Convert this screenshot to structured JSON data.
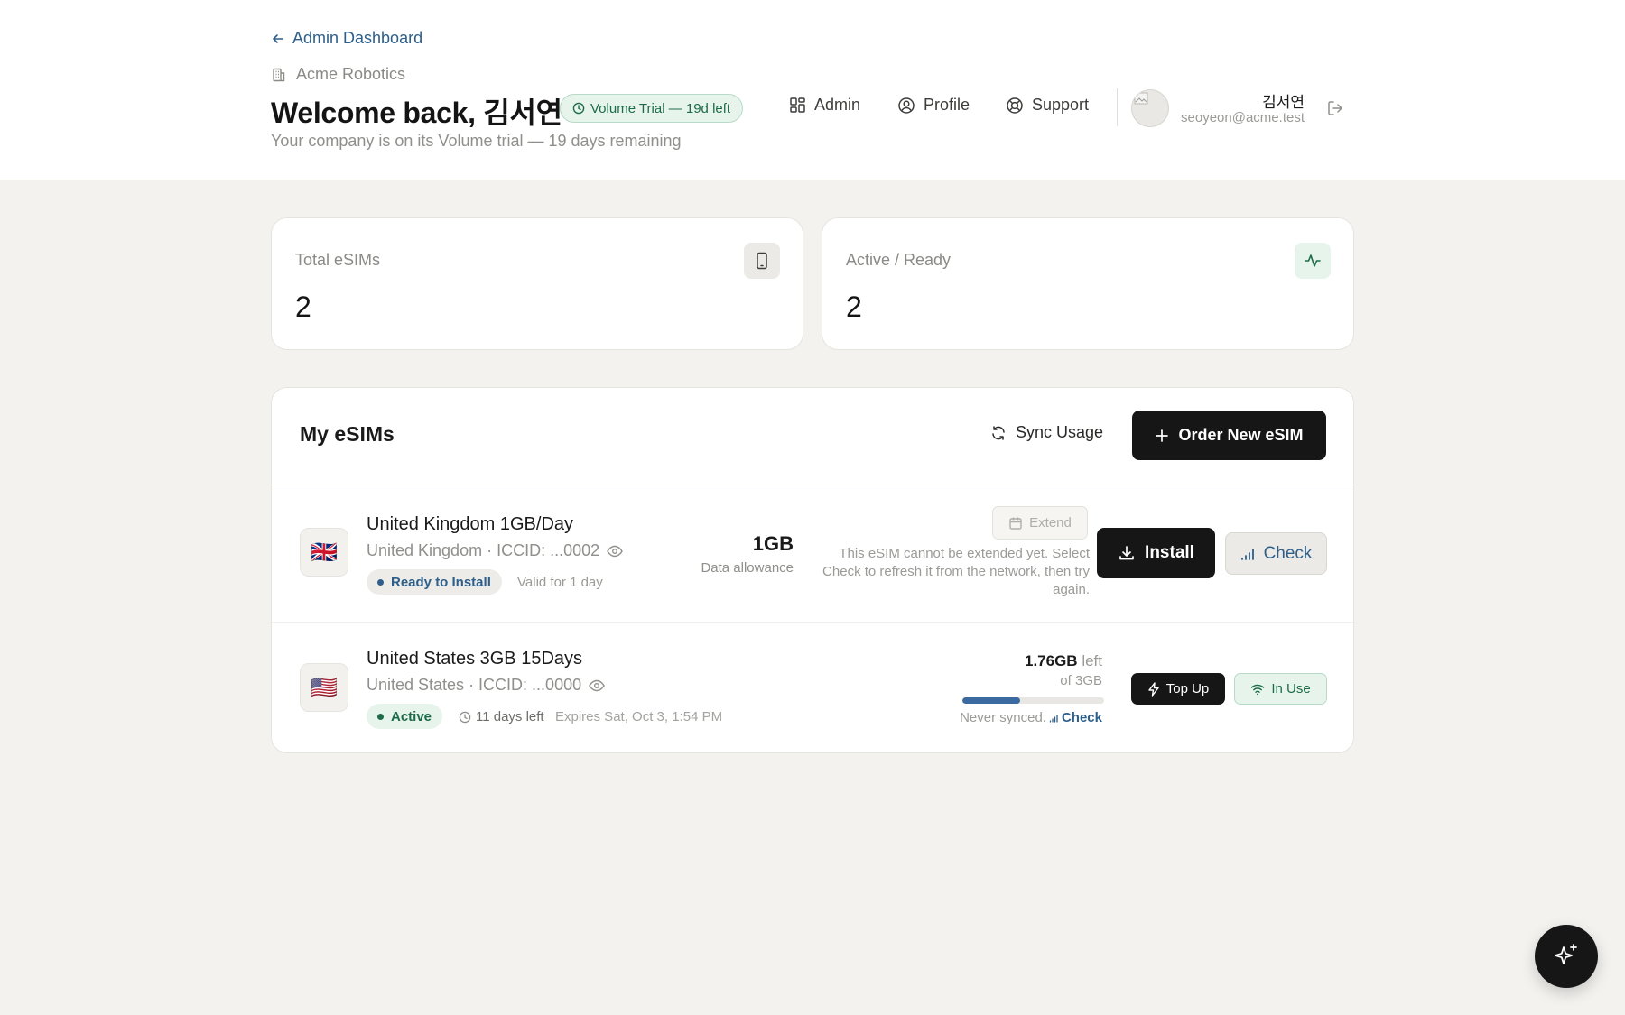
{
  "header": {
    "back_label": "Admin Dashboard",
    "company": "Acme Robotics",
    "welcome": "Welcome back, 김서연",
    "trial_badge": "Volume Trial — 19d left",
    "subtitle": "Your company is on its Volume trial — 19 days remaining",
    "nav": {
      "admin": "Admin",
      "profile": "Profile",
      "support": "Support"
    },
    "user": {
      "name": "김서연",
      "email": "seoyeon@acme.test"
    }
  },
  "stats": [
    {
      "label": "Total eSIMs",
      "value": "2",
      "icon": "smartphone-icon"
    },
    {
      "label": "Active / Ready",
      "value": "2",
      "icon": "activity-icon"
    }
  ],
  "esims_panel": {
    "title": "My eSIMs",
    "sync_label": "Sync Usage",
    "order_label": "Order New eSIM",
    "items": [
      {
        "flag": "🇬🇧",
        "name": "United Kingdom 1GB/Day",
        "sub": "United Kingdom · ICCID: ...0002",
        "status": "Ready to Install",
        "meta": "Valid for 1 day",
        "allocation": "1GB",
        "allocation_label": "Data allowance",
        "extend_label": "Extend",
        "extend_note": "This eSIM cannot be extended yet. Select Check to refresh it from the network, then try again.",
        "install_label": "Install",
        "check_label": "Check"
      },
      {
        "flag": "🇺🇸",
        "name": "United States 3GB 15Days",
        "sub": "United States · ICCID: ...0000",
        "status": "Active",
        "days_left": "11 days left",
        "expires": "Expires Sat, Oct 3, 1:54 PM",
        "left_value": "1.76GB",
        "left_word": "left",
        "of_total": "of 3GB",
        "usage_fraction": 0.41,
        "sync_text": "Never synced.",
        "check_label": "Check",
        "topup_label": "Top Up",
        "inuse_label": "In Use"
      }
    ]
  },
  "colors": {
    "accent_blue": "#2d5f8a",
    "active_green": "#1d6b47",
    "ready_blue": "#2d5f8a",
    "progress": "#3a6aa0"
  }
}
